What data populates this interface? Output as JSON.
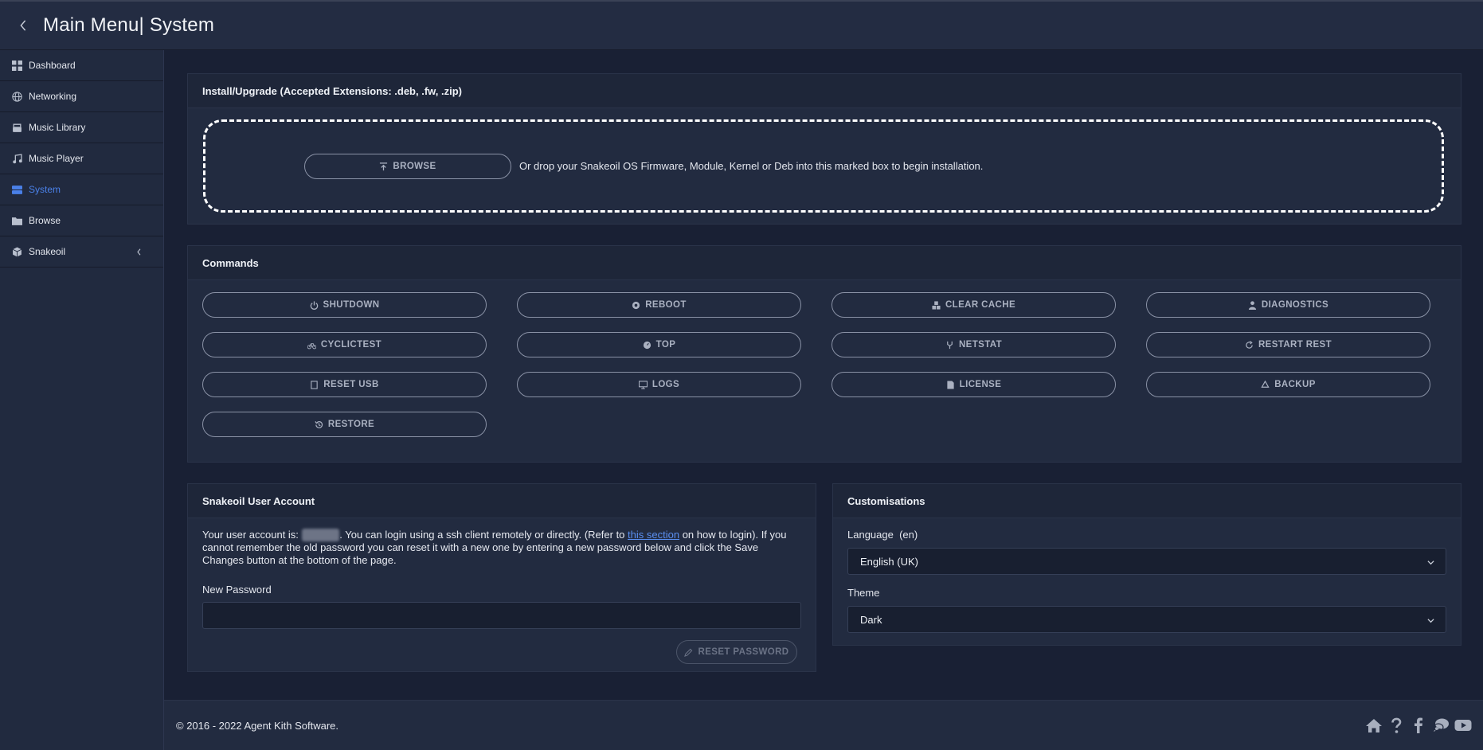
{
  "header": {
    "title": "Main Menu| System"
  },
  "sidebar": {
    "items": [
      {
        "label": "Dashboard",
        "icon": "dashboard-icon"
      },
      {
        "label": "Networking",
        "icon": "globe-icon"
      },
      {
        "label": "Music Library",
        "icon": "library-icon"
      },
      {
        "label": "Music Player",
        "icon": "music-note-icon"
      },
      {
        "label": "System",
        "icon": "server-icon",
        "active": true
      },
      {
        "label": "Browse",
        "icon": "folder-icon"
      },
      {
        "label": "Snakeoil",
        "icon": "cube-icon"
      }
    ]
  },
  "install": {
    "title": "Install/Upgrade (Accepted Extensions: .deb, .fw, .zip)",
    "browse_label": "BROWSE",
    "drop_text": "Or drop your Snakeoil OS Firmware, Module, Kernel or Deb into this marked box to begin installation."
  },
  "commands": {
    "title": "Commands",
    "buttons": [
      "SHUTDOWN",
      "REBOOT",
      "CLEAR CACHE",
      "DIAGNOSTICS",
      "CYCLICTEST",
      "TOP",
      "NETSTAT",
      "RESTART REST",
      "RESET USB",
      "LOGS",
      "LICENSE",
      "BACKUP",
      "RESTORE"
    ]
  },
  "account": {
    "title": "Snakeoil User Account",
    "text_before": "Your user account is: ",
    "username": "snakeoil",
    "text_mid": ". You can login using a ssh client remotely or directly. (Refer to ",
    "link": "this section",
    "text_after": " on how to login). If you cannot remember the old password you can reset it with a new one by entering a new password below and click the Save Changes button at the bottom of the page.",
    "password_label": "New Password",
    "password_value": "",
    "reset_label": "RESET PASSWORD"
  },
  "custom": {
    "title": "Customisations",
    "language_label": "Language  (en)",
    "language_value": "English (UK)",
    "theme_label": "Theme",
    "theme_value": "Dark"
  },
  "footer": {
    "copyright": "© 2016 - 2022 Agent Kith Software."
  },
  "colors": {
    "accent": "#4a80e8",
    "background": "#1a2033",
    "card": "#222b40"
  }
}
